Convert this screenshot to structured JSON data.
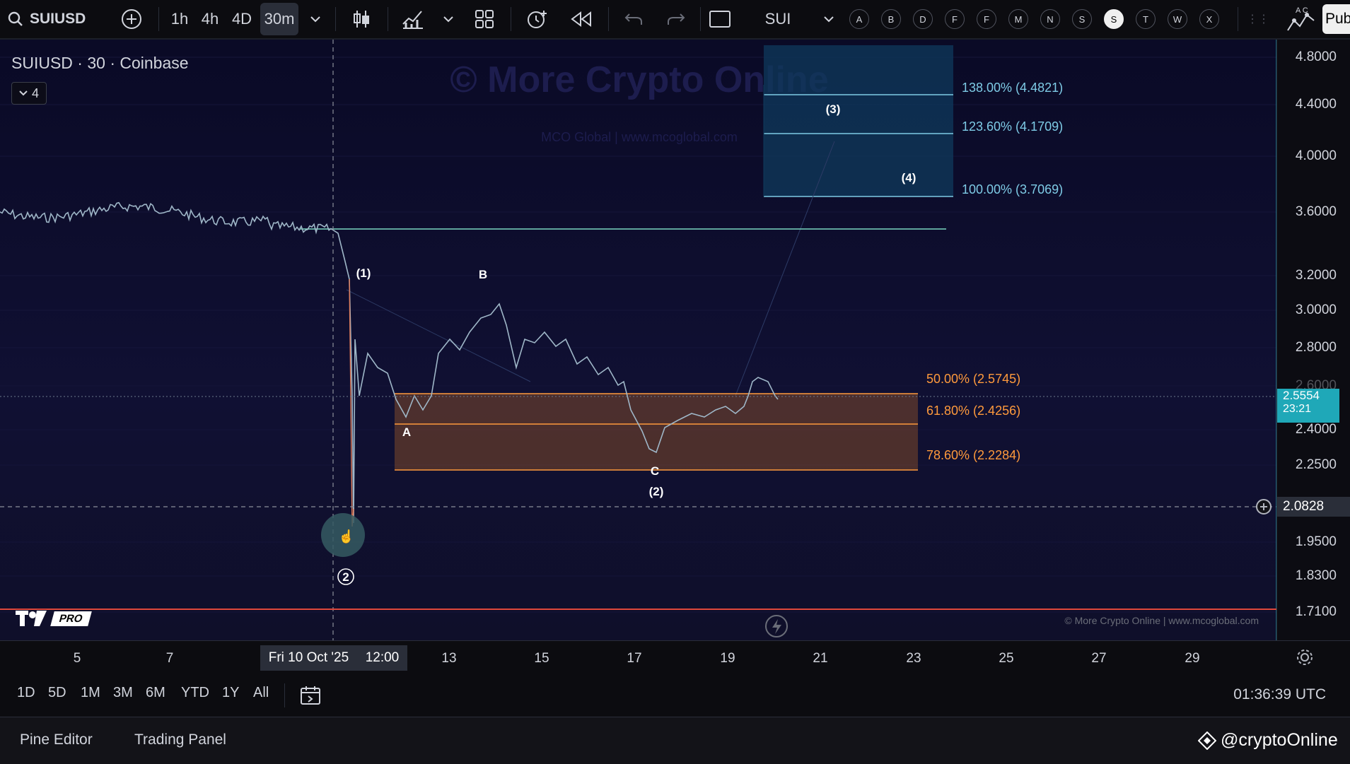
{
  "toolbar": {
    "symbol": "SUIUSD",
    "intervals": [
      "1h",
      "4h",
      "4D",
      "30m"
    ],
    "active_interval": "30m",
    "watch_symbol": "SUI",
    "letter_buttons": [
      "A",
      "B",
      "D",
      "F",
      "F",
      "M",
      "N",
      "S",
      "S",
      "T",
      "W",
      "X"
    ],
    "active_letter_index": 8,
    "publish_label": "Pub",
    "alert_letters": "A C"
  },
  "chart": {
    "title": "SUIUSD · 30 · Coinbase",
    "indicator_count": "4",
    "watermark_main": "© More Crypto Online",
    "watermark_sub": "MCO Global  |  www.mcoglobal.com",
    "footer_watermark": "© More Crypto Online  |  www.mcoglobal.com",
    "logo_badge": "PRO",
    "fib_upper": [
      {
        "label": "138.00% (4.4821)",
        "price": 4.4821
      },
      {
        "label": "123.60% (4.1709)",
        "price": 4.1709
      },
      {
        "label": "100.00% (3.7069)",
        "price": 3.7069
      }
    ],
    "fib_lower": [
      {
        "label": "50.00% (2.5745)",
        "price": 2.5745
      },
      {
        "label": "61.80% (2.4256)",
        "price": 2.4256
      },
      {
        "label": "78.60% (2.2284)",
        "price": 2.2284
      }
    ],
    "wave_labels": [
      "(1)",
      "B",
      "A",
      "C",
      "(2)",
      "(3)",
      "(4)",
      "2"
    ],
    "colors": {
      "fib_upper": "#7ecbe6",
      "fib_lower": "#ff9a3c",
      "candle_up": "#8fb8c9",
      "candle_down": "#e07b59",
      "last_price": "#1fa8b8",
      "crosshair_badge": "#2a2e39"
    }
  },
  "price_axis": {
    "labels": [
      "4.8000",
      "4.4000",
      "4.0000",
      "3.6000",
      "3.2000",
      "3.0000",
      "2.8000",
      "2.6000",
      "2.4000",
      "2.2500",
      "1.9500",
      "1.8300",
      "1.7100"
    ],
    "last_price": "2.5554",
    "countdown": "23:21",
    "crosshair_price": "2.0828"
  },
  "time_axis": {
    "labels": [
      "5",
      "7",
      "13",
      "15",
      "17",
      "19",
      "21",
      "23",
      "25",
      "27",
      "29"
    ],
    "crosshair_date": "Fri 10 Oct '25",
    "crosshair_time": "12:00"
  },
  "range_bar": {
    "ranges": [
      "1D",
      "5D",
      "1M",
      "3M",
      "6M",
      "YTD",
      "1Y",
      "All"
    ],
    "clock": "01:36:39 UTC"
  },
  "bottom_bar": {
    "tabs": [
      "Pine Editor",
      "Trading Panel"
    ],
    "handle": "@cryptoOnline"
  }
}
